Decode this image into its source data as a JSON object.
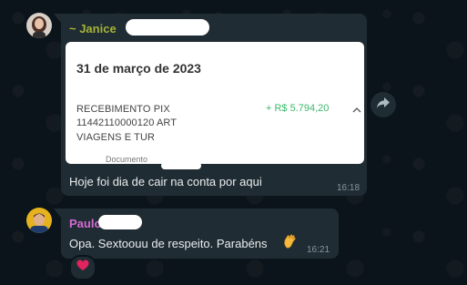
{
  "colors": {
    "chat_background": "#0b141a",
    "bubble_incoming": "#202c33",
    "sender_janice": "#a5b337",
    "sender_paulo": "#d36bd1",
    "amount_positive": "#3db86b",
    "timestamp": "#8696a0",
    "reaction_heart": "#e0245e"
  },
  "messages": [
    {
      "sender": "~ Janice",
      "attachment": {
        "date": "31 de março de 2023",
        "description_lines": [
          "RECEBIMENTO PIX",
          "11442110000120 ART",
          "VIAGENS E TUR"
        ],
        "amount": "+ R$ 5.794,20",
        "footer": "Documento"
      },
      "text": "Hoje foi dia de cair na conta por aqui",
      "time": "16:18",
      "icons": [
        "avatar-janice",
        "chevron-up-icon",
        "forward-icon"
      ]
    },
    {
      "sender": "Paulo",
      "text": "Opa. Sextoouu de respeito. Parabéns",
      "time": "16:21",
      "icons": [
        "avatar-paulo",
        "waving-hand-icon",
        "heart-icon"
      ]
    }
  ]
}
